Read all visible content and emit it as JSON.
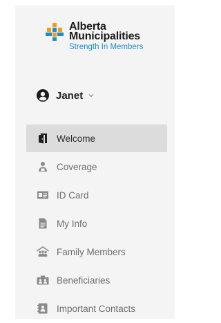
{
  "brand": {
    "name_line1": "Alberta",
    "name_line2": "Municipalities",
    "tagline": "Strength In Members",
    "colors": {
      "orange": "#f39b1f",
      "blue": "#1f8ec6",
      "text": "#1a1a1a"
    }
  },
  "user": {
    "name": "Janet",
    "icon": "account-circle-icon",
    "caret_icon": "chevron-down-icon"
  },
  "nav": {
    "active_color": "#dcdcdc",
    "items": [
      {
        "label": "Welcome",
        "icon": "door-enter-icon",
        "active": true
      },
      {
        "label": "Coverage",
        "icon": "person-shield-icon",
        "active": false
      },
      {
        "label": "ID Card",
        "icon": "id-card-icon",
        "active": false
      },
      {
        "label": "My Info",
        "icon": "document-icon",
        "active": false
      },
      {
        "label": "Family Members",
        "icon": "family-icon",
        "active": false
      },
      {
        "label": "Beneficiaries",
        "icon": "beneficiaries-icon",
        "active": false
      },
      {
        "label": "Important Contacts",
        "icon": "contact-book-icon",
        "active": false
      }
    ]
  }
}
